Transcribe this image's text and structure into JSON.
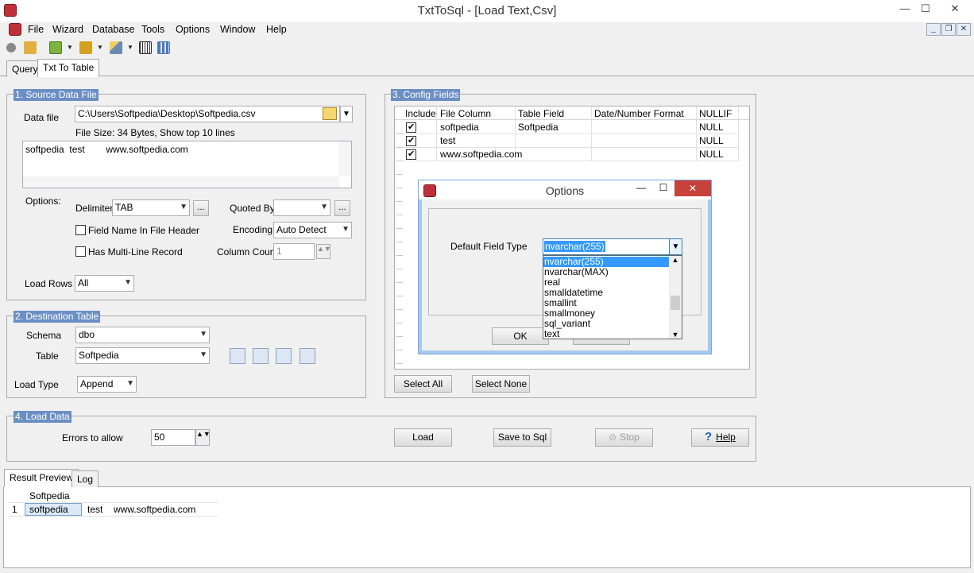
{
  "window": {
    "title": "TxtToSql - [Load Text,Csv]",
    "minimize": "—",
    "maximize": "☐",
    "close": "✕"
  },
  "menu": [
    "File",
    "Wizard",
    "Database",
    "Tools",
    "Options",
    "Window",
    "Help"
  ],
  "mdi": {
    "minimize": "_",
    "restore": "❐",
    "close": "✕"
  },
  "toolbar_icons": [
    "connect-icon",
    "disconnect-icon",
    "new-query-icon",
    "export-icon",
    "wand-icon",
    "barcode-icon",
    "columns-icon"
  ],
  "tabs": {
    "query": "Query",
    "txt_to_table": "Txt To Table"
  },
  "source": {
    "title": "1. Source Data File",
    "data_file_label": "Data file",
    "data_file_value": "C:\\Users\\Softpedia\\Desktop\\Softpedia.csv",
    "file_info": "File Size: 34 Bytes,  Show top 10 lines",
    "preview": "softpedia  test        www.softpedia.com",
    "options_label": "Options:",
    "delimiter_label": "Delimiter",
    "delimiter_value": "TAB",
    "quoted_by_label": "Quoted By",
    "quoted_by_value": "",
    "ellipsis": "...",
    "field_name_header": "Field Name In File Header",
    "encoding_label": "Encoding",
    "encoding_value": "Auto Detect",
    "multiline": "Has Multi-Line Record",
    "column_count_label": "Column Count",
    "column_count_value": "1",
    "load_rows_label": "Load Rows",
    "load_rows_value": "All"
  },
  "destination": {
    "title": "2. Destination Table",
    "schema_label": "Schema",
    "schema_value": "dbo",
    "table_label": "Table",
    "table_value": "Softpedia",
    "load_type_label": "Load Type",
    "load_type_value": "Append"
  },
  "config": {
    "title": "3. Config Fields",
    "headers": [
      "Include",
      "File Column",
      "Table Field",
      "Date/Number Format",
      "NULLIF"
    ],
    "rows": [
      {
        "file_column": "softpedia",
        "table_field": "Softpedia",
        "format": "",
        "nullif": "NULL"
      },
      {
        "file_column": "test",
        "table_field": "",
        "format": "",
        "nullif": "NULL"
      },
      {
        "file_column": "www.softpedia.com",
        "table_field": "",
        "format": "",
        "nullif": "NULL"
      }
    ],
    "select_all": "Select All",
    "select_none": "Select None"
  },
  "load": {
    "title": "4. Load Data",
    "errors_label": "Errors to allow",
    "errors_value": "50",
    "load_btn": "Load",
    "save_btn": "Save to Sql",
    "stop_btn": "Stop",
    "help_btn": "Help"
  },
  "result_tabs": {
    "preview": "Result Preview",
    "log": "Log"
  },
  "result": {
    "header": "Softpedia",
    "row_num": "1",
    "cells": [
      "softpedia",
      "test",
      "www.softpedia.com"
    ]
  },
  "options_dialog": {
    "title": "Options",
    "min": "—",
    "max": "☐",
    "close": "✕",
    "default_field_type_label": "Default Field Type",
    "selected": "nvarchar(255)",
    "list": [
      "nvarchar(255)",
      "nvarchar(MAX)",
      "real",
      "smalldatetime",
      "smallint",
      "smallmoney",
      "sql_variant",
      "text"
    ],
    "ok": "OK",
    "cancel": "Cancel"
  }
}
